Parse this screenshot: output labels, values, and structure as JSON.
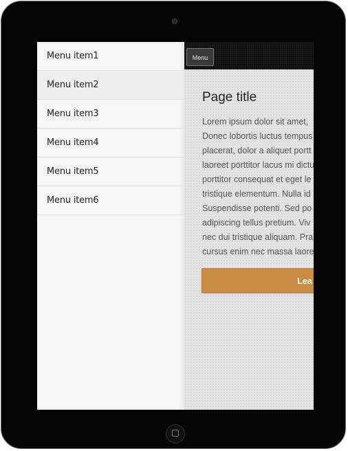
{
  "menu": {
    "items": [
      {
        "label": "Menu item1"
      },
      {
        "label": "Menu item2"
      },
      {
        "label": "Menu item3"
      },
      {
        "label": "Menu item4"
      },
      {
        "label": "Menu item5"
      },
      {
        "label": "Menu item6"
      }
    ],
    "active_index": 1
  },
  "topbar": {
    "menu_button_label": "Menu"
  },
  "main": {
    "title": "Page title",
    "body_lines": [
      "Lorem ipsum dolor sit amet,",
      "Donec lobortis luctus tempus",
      "placerat, dolor a aliquet portt",
      "laoreet porttitor lacus mi dictu",
      "porttitor consequat et eget le",
      "tristique elementum. Nulla id",
      "Suspendisse potenti. Sed po",
      "adipiscing tellus pretium. Viv",
      "nec dui tristique aliquam. Pra",
      "cursus enim nec massa laore"
    ],
    "cta_label": "Lea"
  },
  "colors": {
    "device_bezel": "#050505",
    "topbar": "#111111",
    "cta": "#c98c45",
    "sidebar": "#f6f6f6",
    "content_bg": "#e3e3e3"
  },
  "icons": {
    "home_button": "home-button-icon",
    "camera": "camera-icon"
  }
}
